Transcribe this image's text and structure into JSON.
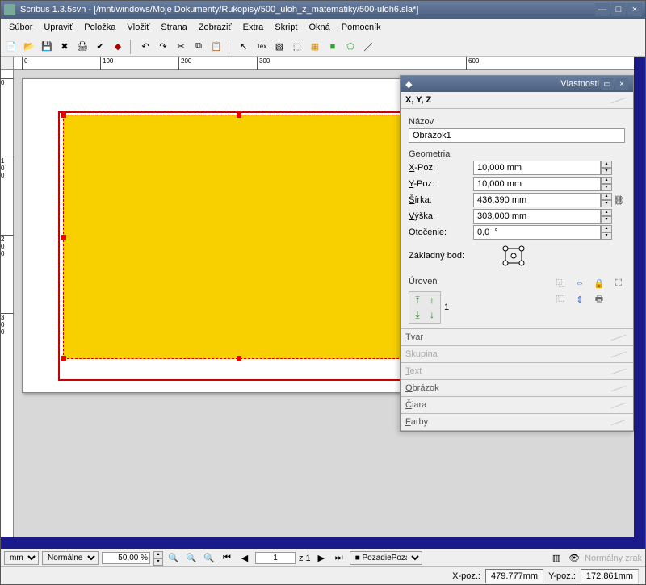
{
  "titlebar": {
    "text": "Scribus 1.3.5svn - [/mnt/windows/Moje Dokumenty/Rukopisy/500_uloh_z_matematiky/500-uloh6.sla*]"
  },
  "menu": {
    "file": "Súbor",
    "edit": "Upraviť",
    "item": "Položka",
    "insert": "Vložiť",
    "page": "Strana",
    "view": "Zobraziť",
    "extra": "Extra",
    "script": "Skript",
    "windows": "Okná",
    "help": "Pomocník"
  },
  "ruler": {
    "h0": "0",
    "h100": "100",
    "h200": "200",
    "h300": "300",
    "h600": "600",
    "v0": "0",
    "v100": "1\n0\n0",
    "v200": "2\n0\n0",
    "v300": "3\n0\n0"
  },
  "panel": {
    "title": "Vlastnosti",
    "xyz": "X, Y, Z",
    "name_label": "Názov",
    "name_value": "Obrázok1",
    "geometry": "Geometria",
    "xpos_label": "X-Poz:",
    "xpos_value": "10,000 mm",
    "ypos_label": "Y-Poz:",
    "ypos_value": "10,000 mm",
    "width_label": "Šírka:",
    "width_value": "436,390 mm",
    "height_label": "Výška:",
    "height_value": "303,000 mm",
    "rotation_label": "Otočenie:",
    "rotation_value": "0,0  °",
    "basepoint": "Základný bod:",
    "level": "Úroveň",
    "level_value": "1",
    "shape": "Tvar",
    "group": "Skupina",
    "text": "Text",
    "image": "Obrázok",
    "line": "Čiara",
    "colors": "Farby"
  },
  "status": {
    "unit": "mm",
    "display": "Normálne",
    "zoom": "50,00 %",
    "page": "1",
    "pages": "z 1",
    "layer": "Pozadie",
    "vision": "Normálny zrak"
  },
  "bottom": {
    "xpos_label": "X-poz.:",
    "xpos": "479.777mm",
    "ypos_label": "Y-poz.:",
    "ypos": "172.861mm"
  }
}
